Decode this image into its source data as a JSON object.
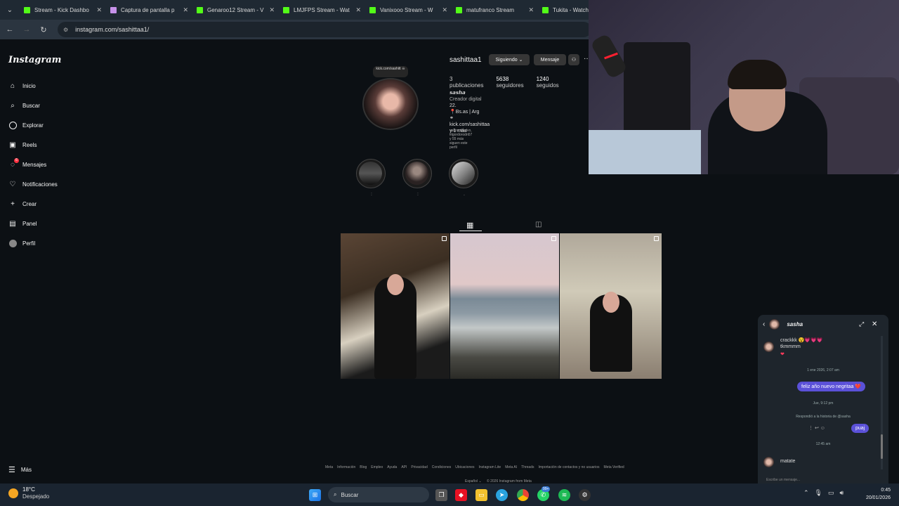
{
  "browser": {
    "tabs": [
      {
        "title": "Stream - Kick Dashbo",
        "icon": "kick-icon"
      },
      {
        "title": "Captura de pantalla p",
        "icon": "snip-icon"
      },
      {
        "title": "Genaroo12 Stream - V",
        "icon": "kick-icon"
      },
      {
        "title": "LMJFPS Stream - Wat",
        "icon": "kick-icon"
      },
      {
        "title": "Vanixooo Stream - W",
        "icon": "kick-icon"
      },
      {
        "title": "matufranco Stream",
        "icon": "kick-icon"
      },
      {
        "title": "Tukita - Watch",
        "icon": "kick-icon"
      }
    ],
    "url": "instagram.com/sashittaa1/"
  },
  "sidebar": {
    "logo": "Instagram",
    "items": [
      {
        "label": "Inicio",
        "icon": "home-icon"
      },
      {
        "label": "Buscar",
        "icon": "search-icon"
      },
      {
        "label": "Explorar",
        "icon": "compass-icon"
      },
      {
        "label": "Reels",
        "icon": "reels-icon"
      },
      {
        "label": "Mensajes",
        "icon": "messenger-icon",
        "badge": "6"
      },
      {
        "label": "Notificaciones",
        "icon": "heart-icon"
      },
      {
        "label": "Crear",
        "icon": "plus-icon"
      },
      {
        "label": "Panel",
        "icon": "dashboard-icon"
      },
      {
        "label": "Perfil",
        "icon": "avatar-icon"
      }
    ],
    "more": "Más"
  },
  "profile": {
    "note": "kick.com/sashitt ☠",
    "username": "sashittaa1",
    "following_btn": "Siguiendo",
    "message_btn": "Mensaje",
    "stats": {
      "posts_count": "3",
      "posts_label": "publicaciones",
      "followers_count": "5638",
      "followers_label": "seguidores",
      "following_count": "1240",
      "following_label": "seguidos"
    },
    "bio": {
      "name": "𝙨𝙖𝙨𝙝𝙖",
      "category": "Creador digital",
      "line1": "22.",
      "line2": "📍Bs.as | Arg",
      "link": "kick.com/sashittaa y 1 más"
    },
    "followed_by": "valenndisalvo, elgordorodri07 y 55 más siguen este perfil",
    "highlights": [
      {
        "label": ":"
      },
      {
        "label": ":"
      },
      {
        "label": "."
      }
    ]
  },
  "footer": {
    "links": [
      "Meta",
      "Información",
      "Blog",
      "Empleo",
      "Ayuda",
      "API",
      "Privacidad",
      "Condiciones",
      "Ubicaciones",
      "Instagram Lite",
      "Meta AI",
      "Threads",
      "Importación de contactos y no usuarios",
      "Meta Verified"
    ],
    "lang": "Español ⌄",
    "copyright": "© 2026 Instagram from Meta"
  },
  "chat": {
    "name": "sasha",
    "msg_in_1a": "crackkk 😵💗💗💗",
    "msg_in_1b": "tkmmmm",
    "msg_in_1c": "❤",
    "time1": "1 ene 2026, 2:07 am",
    "msg_out_1": "feliz año nuevo negritaa ❤️",
    "time2": "Jue, 9:12 pm",
    "story_reply": "Respondió a la historia de @sasha",
    "msg_out_2": "puaj",
    "time3": "12:45 am",
    "msg_in_2": "matate",
    "input_placeholder": "Escribe un mensaje..."
  },
  "taskbar": {
    "temp": "18°C",
    "weather": "Despejado",
    "search": "Buscar",
    "whatsapp_badge": "99+",
    "time": "0:45",
    "date": "20/01/2026"
  }
}
